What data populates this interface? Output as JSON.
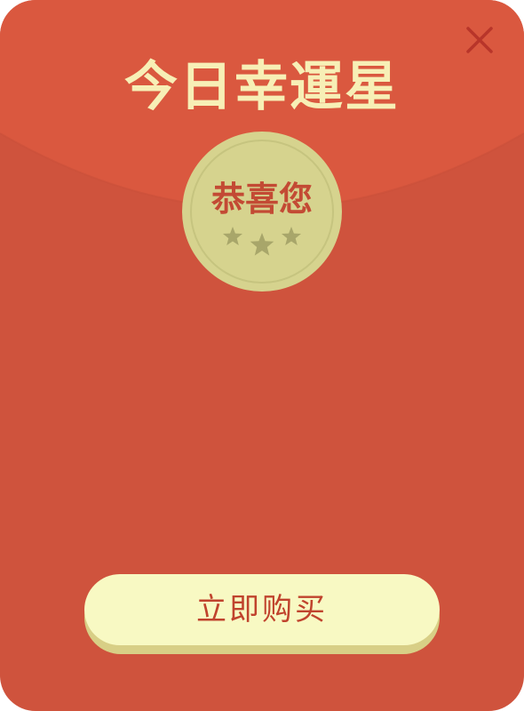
{
  "popup": {
    "title": "今日幸運星",
    "coin_text": "恭喜您",
    "buy_button_label": "立即购买"
  },
  "colors": {
    "envelope_body": "#cf533d",
    "envelope_flap": "#da583f",
    "title_text": "#f7efb6",
    "coin_face": "#d6d38e",
    "coin_text": "#c34a34",
    "stars": "#a8a66a",
    "button_face": "#f8f9c3",
    "button_shadow": "#d8cf86",
    "button_text": "#c0432d",
    "close_icon": "#b8352a"
  },
  "icons": {
    "close": "close-icon",
    "stars": "star-icon"
  }
}
